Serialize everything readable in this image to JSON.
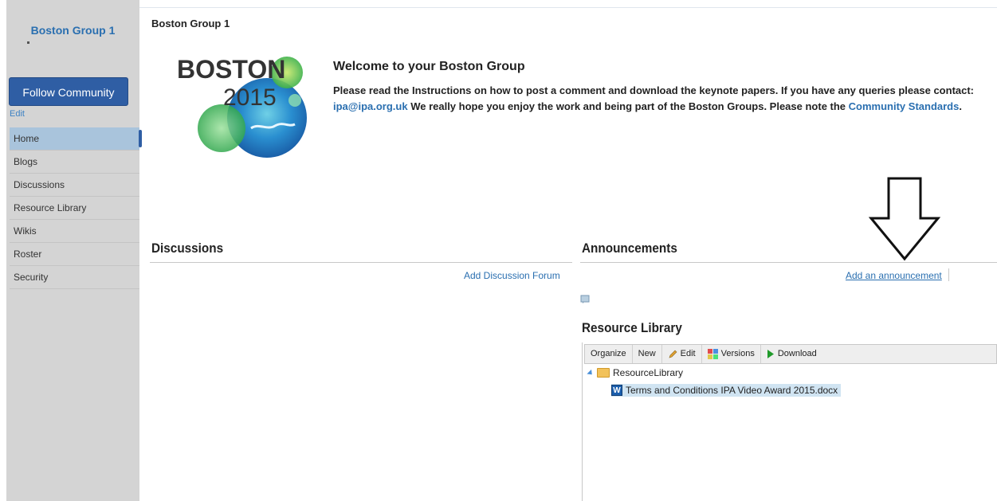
{
  "sidebar": {
    "title": "Boston Group 1",
    "follow_button": "Follow Community",
    "edit_link": "Edit",
    "nav": [
      {
        "label": "Home",
        "active": true
      },
      {
        "label": "Blogs"
      },
      {
        "label": "Discussions"
      },
      {
        "label": "Resource Library"
      },
      {
        "label": "Wikis"
      },
      {
        "label": "Roster"
      },
      {
        "label": "Security"
      }
    ]
  },
  "main": {
    "page_title": "Boston Group 1",
    "logo": {
      "line1": "BOSTON",
      "line2": "2015"
    },
    "welcome_heading": "Welcome to your Boston Group",
    "welcome_text_1": "Please read the Instructions on how to post a comment and download the keynote papers. If you have any queries please contact: ",
    "welcome_email": "ipa@ipa.org.uk",
    "welcome_text_2": " We really hope you enjoy the work and being part of the Boston Groups. Please note the ",
    "welcome_standards_link": "Community Standards",
    "welcome_text_3": "."
  },
  "discussions": {
    "heading": "Discussions",
    "add_link": "Add Discussion Forum"
  },
  "announcements": {
    "heading": "Announcements",
    "add_link": "Add an announcement"
  },
  "resource_library": {
    "heading": "Resource Library",
    "toolbar": {
      "organize": "Organize",
      "new": "New",
      "edit": "Edit",
      "versions": "Versions",
      "download": "Download"
    },
    "folder": "ResourceLibrary",
    "file": "Terms and Conditions IPA Video Award 2015.docx"
  },
  "colors": {
    "sidebar_bg": "#d4d4d4",
    "accent": "#2f5ea4",
    "link": "#2a6fb0",
    "active_nav": "#a9c4dc"
  }
}
